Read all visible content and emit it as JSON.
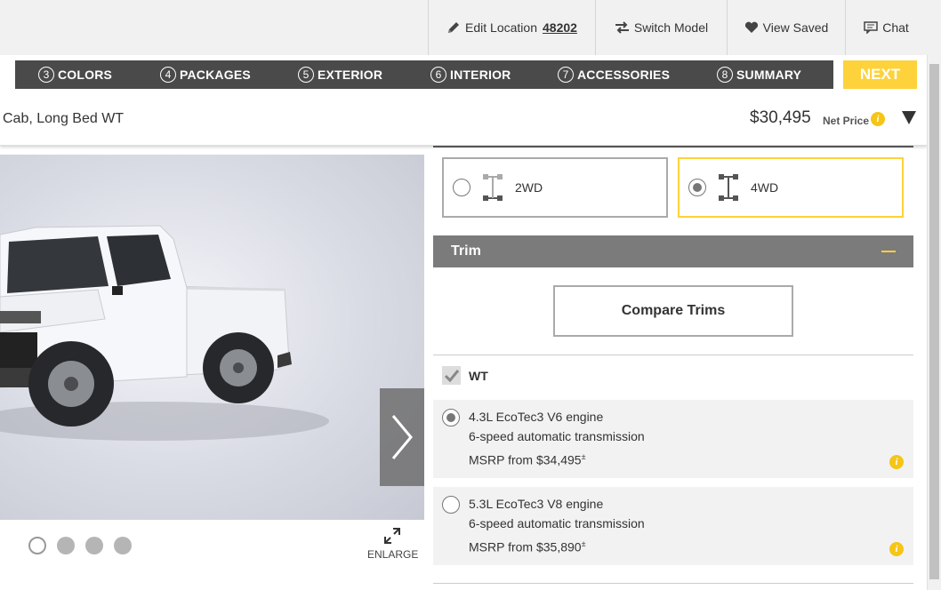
{
  "topbar": {
    "edit_location_label": "Edit Location",
    "zip": "48202",
    "switch_model_label": "Switch Model",
    "view_saved_label": "View Saved",
    "chat_label": "Chat"
  },
  "steps": [
    {
      "num": "3",
      "label": "COLORS"
    },
    {
      "num": "4",
      "label": "PACKAGES"
    },
    {
      "num": "5",
      "label": "EXTERIOR"
    },
    {
      "num": "6",
      "label": "INTERIOR"
    },
    {
      "num": "7",
      "label": "ACCESSORIES"
    },
    {
      "num": "8",
      "label": "SUMMARY"
    }
  ],
  "next_label": "NEXT",
  "vehicle": {
    "name": "Cab, Long Bed WT",
    "price": "$30,495",
    "price_label": "Net Price"
  },
  "gallery": {
    "total_images": 4,
    "active_index": 0,
    "enlarge_label": "ENLARGE"
  },
  "drive": {
    "options": [
      {
        "label": "2WD",
        "selected": false
      },
      {
        "label": "4WD",
        "selected": true
      }
    ]
  },
  "trim": {
    "header": "Trim",
    "compare_label": "Compare Trims",
    "selected_trim": "WT",
    "engines": [
      {
        "engine": "4.3L EcoTec3 V6 engine",
        "transmission": "6-speed automatic transmission",
        "msrp": "MSRP from $34,495",
        "footnote": "±",
        "selected": true
      },
      {
        "engine": "5.3L EcoTec3 V8 engine",
        "transmission": "6-speed automatic transmission",
        "msrp": "MSRP from $35,890",
        "footnote": "±",
        "selected": false
      }
    ]
  },
  "colors": {
    "accent": "#fdd23b",
    "nav_bg": "#4a4a4a",
    "trim_bar": "#7b7b7b",
    "info": "#f5c518"
  }
}
